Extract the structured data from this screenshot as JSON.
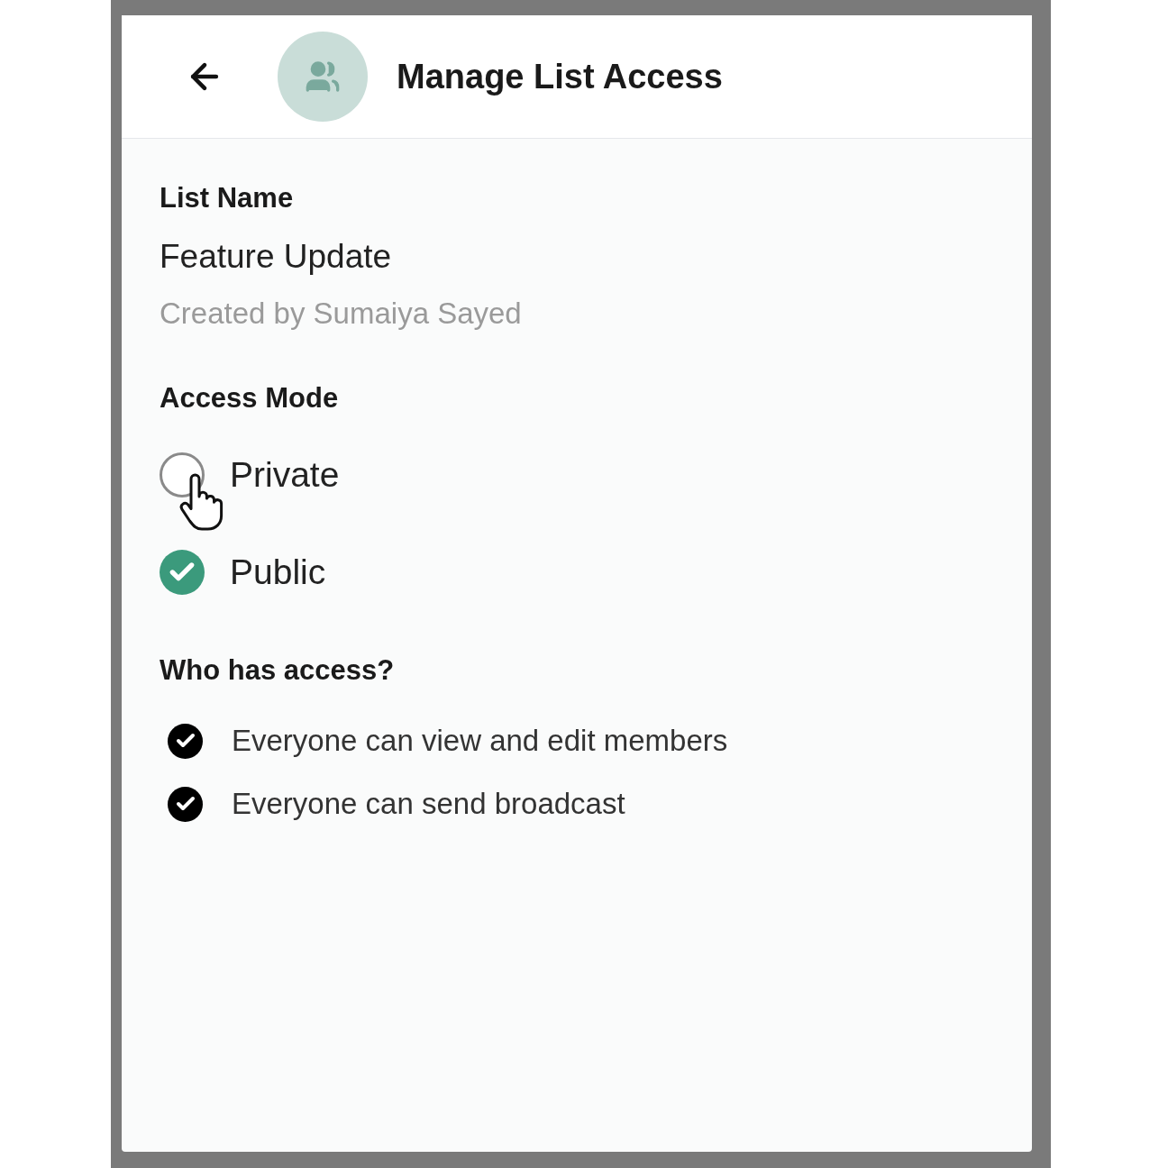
{
  "header": {
    "title": "Manage List Access"
  },
  "list_name": {
    "label": "List Name",
    "value": "Feature Update",
    "creator": "Created by Sumaiya Sayed"
  },
  "access_mode": {
    "heading": "Access Mode",
    "options": [
      {
        "label": "Private",
        "selected": false
      },
      {
        "label": "Public",
        "selected": true
      }
    ]
  },
  "access": {
    "heading": "Who has access?",
    "permissions": [
      {
        "label": "Everyone can view and edit members",
        "checked": true
      },
      {
        "label": "Everyone can send broadcast",
        "checked": true
      }
    ]
  }
}
